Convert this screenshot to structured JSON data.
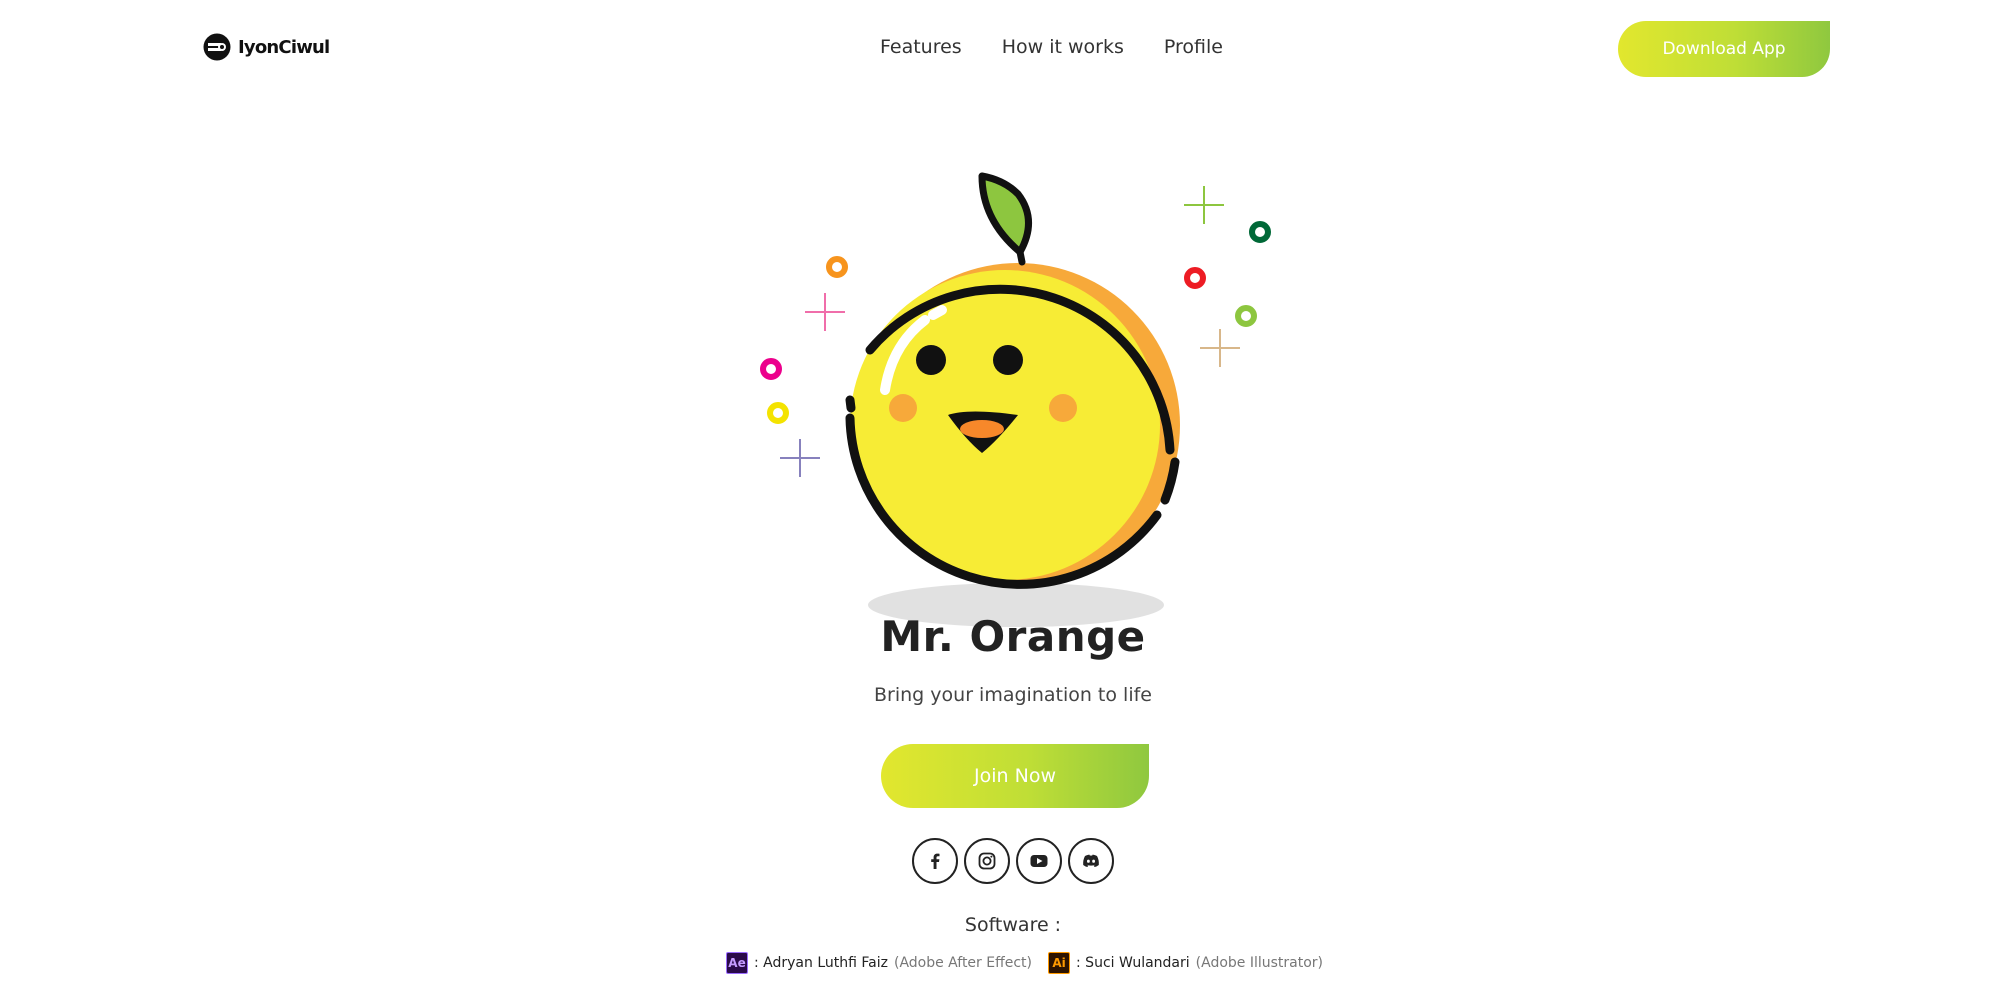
{
  "brand": {
    "name": "IyonCiwul"
  },
  "nav": {
    "links": [
      "Features",
      "How it works",
      "Profile"
    ],
    "download_label": "Download App"
  },
  "hero": {
    "title": "Mr. Orange",
    "subtitle": "Bring your imagination to life",
    "join_label": "Join Now",
    "colors": {
      "fruit": "#f7ec35",
      "fruit_shade": "#f7a93a",
      "leaf": "#8dc63f",
      "button_start": "#e2e72e",
      "button_end": "#8fc83f"
    }
  },
  "socials": [
    "facebook-icon",
    "instagram-icon",
    "youtube-icon",
    "discord-icon"
  ],
  "software": {
    "label": "Software :",
    "credits": [
      {
        "badge": "Ae",
        "person": ": Adryan Luthfi Faiz",
        "tool": "(Adobe After Effect)"
      },
      {
        "badge": "Ai",
        "person": ": Suci Wulandari",
        "tool": "(Adobe Illustrator)"
      }
    ]
  }
}
